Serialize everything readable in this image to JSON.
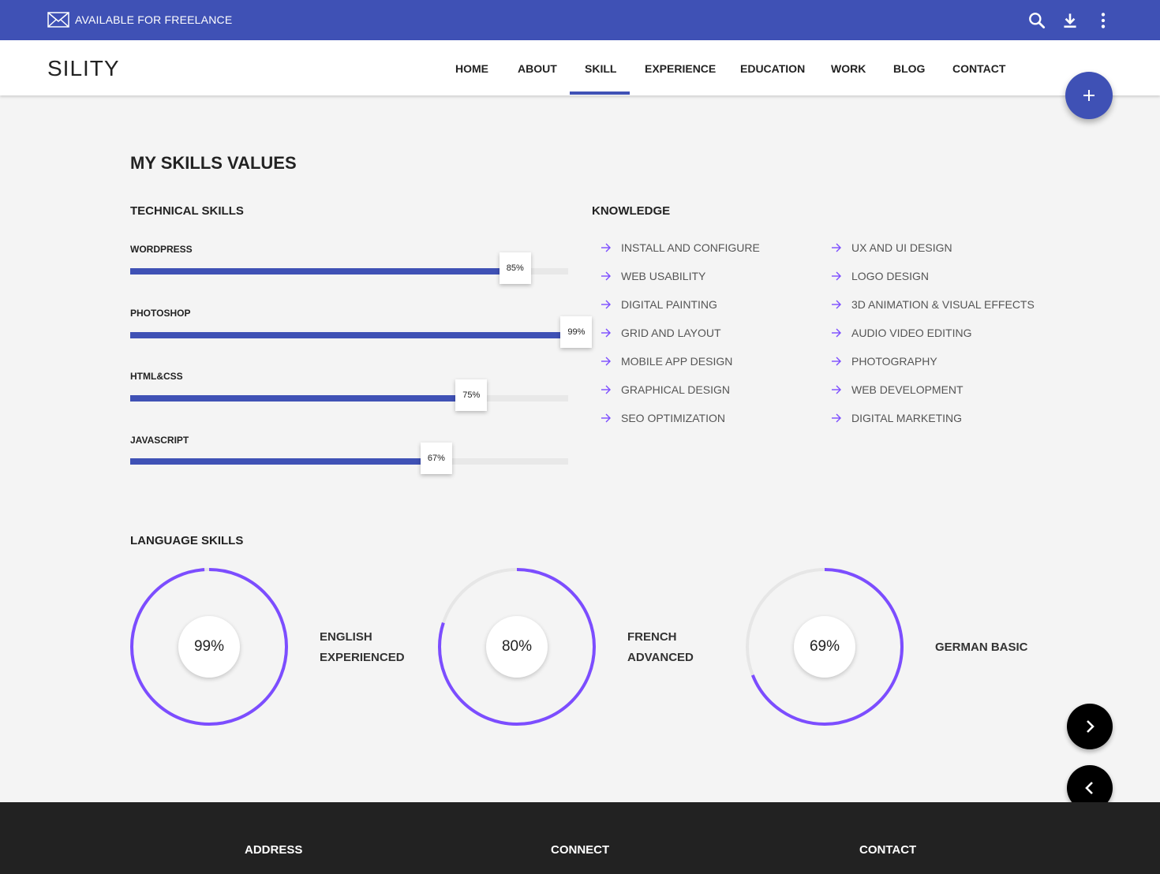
{
  "topbar": {
    "freelance_text": "AVAILABLE FOR FREELANCE",
    "icons": [
      "mail-icon",
      "search-icon",
      "download-icon",
      "more-vert-icon"
    ],
    "color": "#3f51b5"
  },
  "navbar": {
    "logo": "SILITY",
    "items": [
      {
        "label": "HOME"
      },
      {
        "label": "ABOUT"
      },
      {
        "label": "SKILL"
      },
      {
        "label": "EXPERIENCE"
      },
      {
        "label": "EDUCATION"
      },
      {
        "label": "WORK"
      },
      {
        "label": "BLOG"
      },
      {
        "label": "CONTACT"
      }
    ],
    "active": "SKILL"
  },
  "skills": {
    "title": "MY SKILLS VALUES",
    "technical_title": "TECHNICAL SKILLS",
    "technical": [
      {
        "name": "WORDPRESS",
        "value": 85,
        "label": "85%"
      },
      {
        "name": "PHOTOSHOP",
        "value": 99,
        "label": "99%"
      },
      {
        "name": "HTML&CSS",
        "value": 75,
        "label": "75%"
      },
      {
        "name": "JAVASCRIPT",
        "value": 67,
        "label": "67%"
      }
    ],
    "knowledge_title": "KNOWLEDGE",
    "knowledge_left": [
      "INSTALL AND CONFIGURE",
      "WEB USABILITY",
      "DIGITAL PAINTING",
      "GRID AND LAYOUT",
      "MOBILE APP DESIGN",
      "GRAPHICAL DESIGN",
      "SEO OPTIMIZATION"
    ],
    "knowledge_right": [
      "UX AND UI DESIGN",
      "LOGO DESIGN",
      "3D ANIMATION & VISUAL EFFECTS",
      "AUDIO VIDEO EDITING",
      "PHOTOGRAPHY",
      "WEB DEVELOPMENT",
      "DIGITAL MARKETING"
    ],
    "language_title": "LANGUAGE SKILLS",
    "languages": [
      {
        "value": 99,
        "label": "99%",
        "line1": "ENGLISH",
        "line2": "EXPERIENCED"
      },
      {
        "value": 80,
        "label": "80%",
        "line1": "FRENCH",
        "line2": "ADVANCED"
      },
      {
        "value": 69,
        "label": "69%",
        "line1": "GERMAN BASIC",
        "line2": ""
      }
    ]
  },
  "footer": {
    "headings": [
      "ADDRESS",
      "CONNECT",
      "CONTACT"
    ]
  },
  "colors": {
    "primary": "#3f51b5",
    "accent": "#7c4dff",
    "ring_track": "#e6e6e6"
  }
}
